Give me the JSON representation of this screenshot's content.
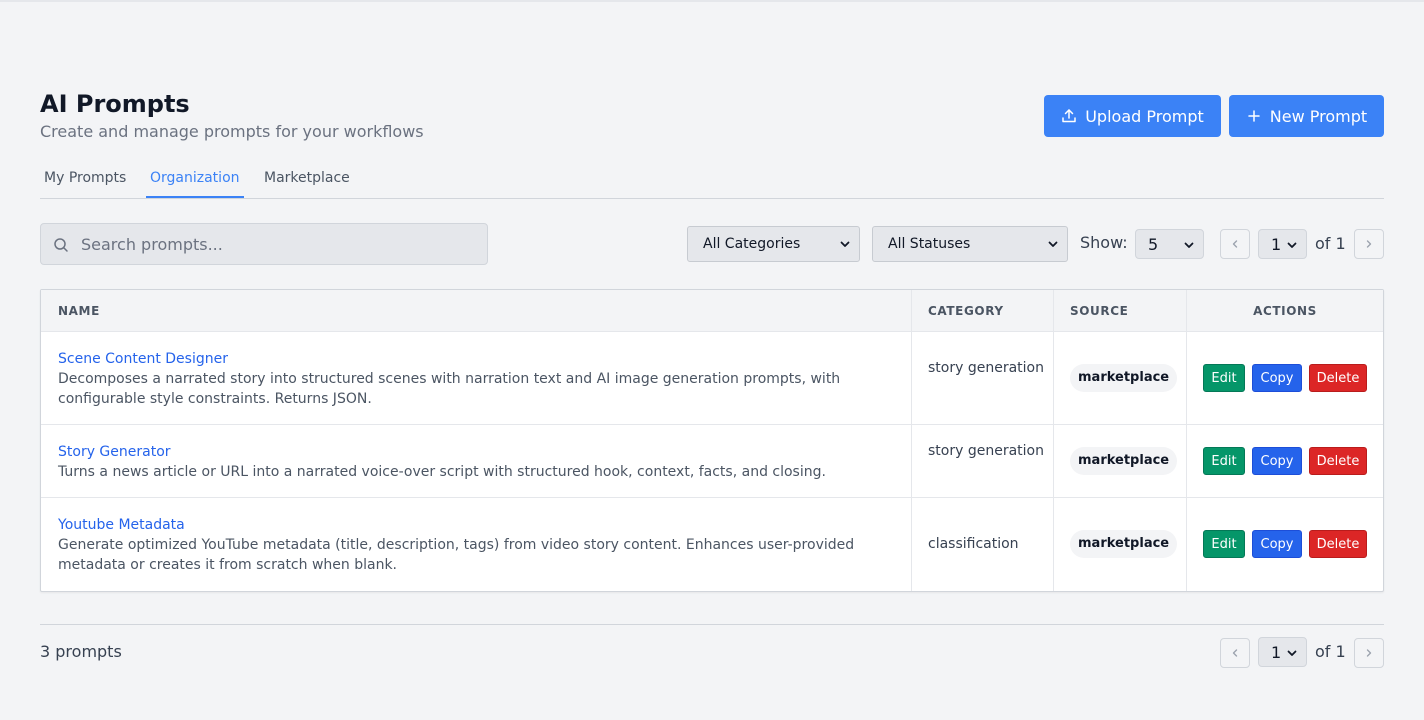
{
  "header": {
    "title": "AI Prompts",
    "subtitle": "Create and manage prompts for your workflows",
    "upload_label": "Upload Prompt",
    "new_label": "New Prompt"
  },
  "tabs": [
    {
      "label": "My Prompts",
      "active": false
    },
    {
      "label": "Organization",
      "active": true
    },
    {
      "label": "Marketplace",
      "active": false
    }
  ],
  "filters": {
    "search_placeholder": "Search prompts...",
    "search_value": "",
    "category": "All Categories",
    "status": "All Statuses",
    "show_label": "Show:",
    "show_value": "5"
  },
  "pagination": {
    "page": "1",
    "of_label": "of 1"
  },
  "table": {
    "headers": [
      "NAME",
      "CATEGORY",
      "SOURCE",
      "ACTIONS"
    ],
    "rows": [
      {
        "name": "Scene Content Designer",
        "description": "Decomposes a narrated story into structured scenes with narration text and AI image generation prompts, with configurable style constraints. Returns JSON.",
        "category": "story generation",
        "source": "marketplace"
      },
      {
        "name": "Story Generator",
        "description": "Turns a news article or URL into a narrated voice-over script with structured hook, context, facts, and closing.",
        "category": "story generation",
        "source": "marketplace"
      },
      {
        "name": "Youtube Metadata",
        "description": "Generate optimized YouTube metadata (title, description, tags) from video story content. Enhances user-provided metadata or creates it from scratch when blank.",
        "category": "classification",
        "source": "marketplace"
      }
    ],
    "actions": {
      "edit": "Edit",
      "copy": "Copy",
      "delete": "Delete"
    }
  },
  "footer": {
    "count_label": "3 prompts"
  },
  "colors": {
    "primary": "#3b82f6",
    "edit": "#059669",
    "copy": "#2563eb",
    "delete": "#dc2626",
    "link": "#2563eb"
  },
  "icons": [
    "upload-icon",
    "plus-icon",
    "search-icon",
    "chevron-down-icon",
    "chevron-left-icon",
    "chevron-right-icon"
  ]
}
